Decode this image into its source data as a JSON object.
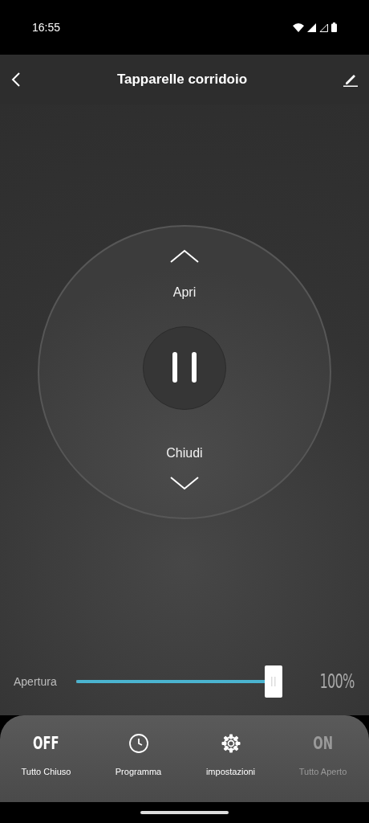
{
  "status_bar": {
    "time": "16:55"
  },
  "header": {
    "title": "Tapparelle corridoio"
  },
  "control": {
    "open_label": "Apri",
    "close_label": "Chiudi"
  },
  "slider": {
    "label": "Apertura",
    "level": 1,
    "reading": "100%"
  },
  "actions": [
    {
      "kind": "text",
      "glyph": "OFF",
      "label": "Tutto Chiuso",
      "disabled": false
    },
    {
      "kind": "clock",
      "label": "Programma",
      "disabled": false
    },
    {
      "kind": "gear",
      "label": "impostazioni",
      "disabled": false
    },
    {
      "kind": "text",
      "glyph": "ON",
      "label": "Tutto Aperto",
      "disabled": true
    }
  ]
}
